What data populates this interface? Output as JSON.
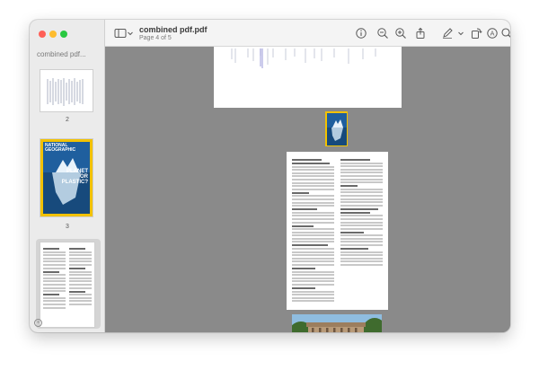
{
  "window": {
    "title": "combined pdf.pdf",
    "subtitle": "Page 4 of 5"
  },
  "sidebar": {
    "title": "combined pdf...",
    "thumbnails": [
      {
        "label": "2"
      },
      {
        "label": "3"
      },
      {
        "label": ""
      }
    ]
  },
  "thumbnail_cover": {
    "masthead": "NATIONAL GEOGRAPHIC",
    "headline": "PLANET OR PLASTIC?"
  },
  "toolbar": {
    "icons": [
      "sidebar-icon",
      "chevron-down-icon",
      "info-icon",
      "zoom-out-icon",
      "zoom-in-icon",
      "share-icon",
      "markup-pen-icon",
      "chevron-down-icon",
      "rotate-icon",
      "annotate-icon",
      "search-icon"
    ]
  },
  "colors": {
    "window_bg": "#8a8a8a",
    "sidebar_bg": "#ebebeb",
    "toolbar_bg": "#f4f4f4",
    "cover_yellow": "#f2c200",
    "cover_blue": "#1f5f9e"
  }
}
